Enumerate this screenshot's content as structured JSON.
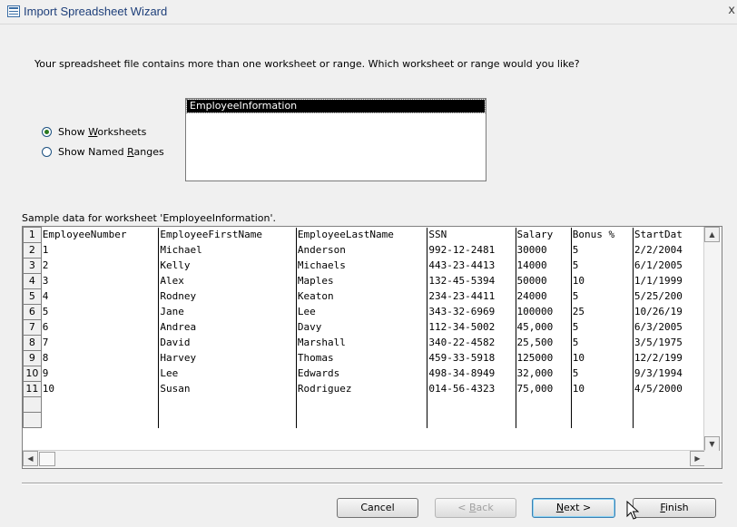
{
  "window": {
    "title": "Import Spreadsheet Wizard",
    "close_glyph": "x"
  },
  "prompt": "Your spreadsheet file contains more than one worksheet or range. Which worksheet or range would you like?",
  "options": {
    "worksheets": {
      "pre": "Show ",
      "key": "W",
      "post": "orksheets",
      "selected": true
    },
    "ranges": {
      "pre": "Show Named ",
      "key": "R",
      "post": "anges",
      "selected": false
    }
  },
  "worksheet_list": [
    "EmployeeInformation"
  ],
  "sample_label": "Sample data for worksheet 'EmployeeInformation'.",
  "grid": {
    "row_numbers": [
      "1",
      "2",
      "3",
      "4",
      "5",
      "6",
      "7",
      "8",
      "9",
      "10",
      "11",
      "",
      ""
    ],
    "rows": [
      [
        "EmployeeNumber",
        "EmployeeFirstName",
        "EmployeeLastName",
        "SSN",
        "Salary",
        "Bonus %",
        "StartDat"
      ],
      [
        "1",
        "Michael",
        "Anderson",
        "992-12-2481",
        "30000",
        "5",
        "2/2/2004"
      ],
      [
        "2",
        "Kelly",
        "Michaels",
        "443-23-4413",
        "14000",
        "5",
        "6/1/2005"
      ],
      [
        "3",
        "Alex",
        "Maples",
        "132-45-5394",
        "50000",
        "10",
        "1/1/1999"
      ],
      [
        "4",
        "Rodney",
        "Keaton",
        "234-23-4411",
        "24000",
        "5",
        "5/25/200"
      ],
      [
        "5",
        "Jane",
        "Lee",
        "343-32-6969",
        "100000",
        "25",
        "10/26/19"
      ],
      [
        "6",
        "Andrea",
        "Davy",
        "112-34-5002",
        "45,000",
        "5",
        "6/3/2005"
      ],
      [
        "7",
        "David",
        "Marshall",
        "340-22-4582",
        "25,500",
        "5",
        "3/5/1975"
      ],
      [
        "8",
        "Harvey",
        "Thomas",
        "459-33-5918",
        "125000",
        "10",
        "12/2/199"
      ],
      [
        "9",
        "Lee",
        "Edwards",
        "498-34-8949",
        "32,000",
        "5",
        "9/3/1994"
      ],
      [
        "10",
        "Susan",
        "Rodriguez",
        "014-56-4323",
        "75,000",
        "10",
        "4/5/2000"
      ],
      [
        "",
        "",
        "",
        "",
        "",
        "",
        ""
      ],
      [
        "",
        "",
        "",
        "",
        "",
        "",
        ""
      ]
    ]
  },
  "buttons": {
    "cancel": "Cancel",
    "back": {
      "pre": "< ",
      "key": "B",
      "post": "ack"
    },
    "next": {
      "key": "N",
      "post": "ext >"
    },
    "finish": {
      "key": "F",
      "post": "inish"
    }
  }
}
